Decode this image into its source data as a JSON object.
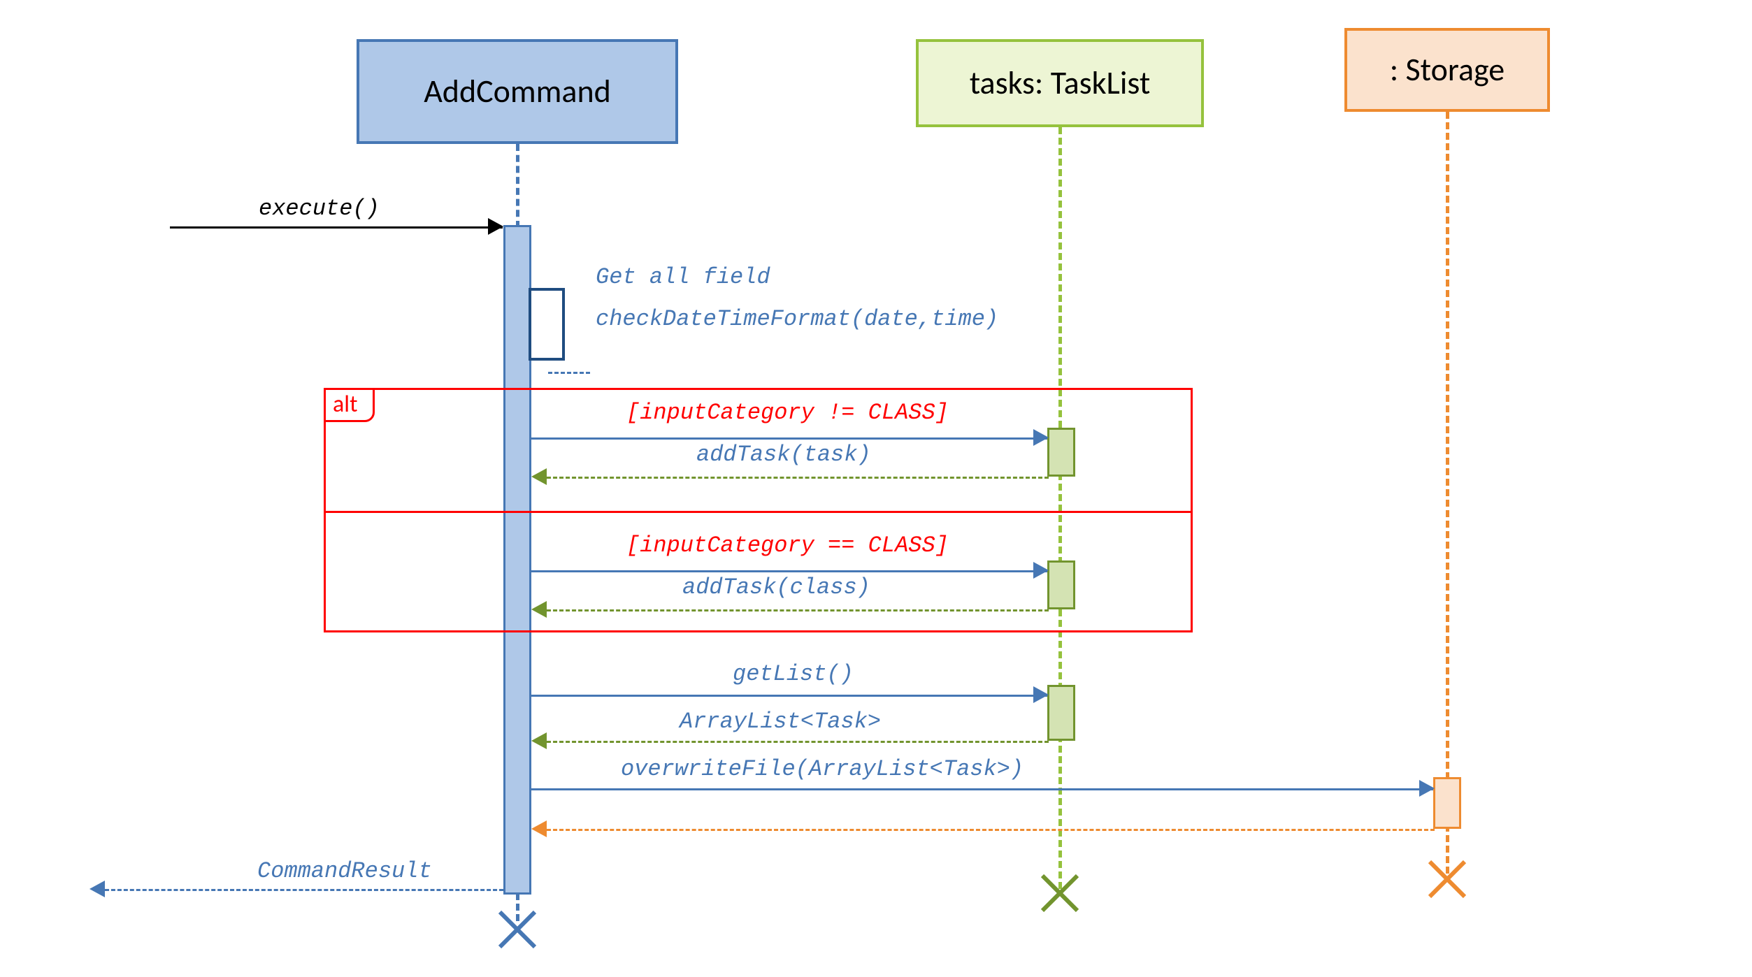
{
  "participants": {
    "addcommand": "AddCommand",
    "tasklist": "tasks: TaskList",
    "storage": ": Storage"
  },
  "messages": {
    "execute": "execute()",
    "note_fields": "Get all field",
    "note_check": "checkDateTimeFormat(date,time)",
    "alt_label": "alt",
    "guard1": "[inputCategory != CLASS]",
    "addtask_task": "addTask(task)",
    "guard2": "[inputCategory == CLASS]",
    "addtask_class": "addTask(class)",
    "getlist": "getList()",
    "arraylist": "ArrayList<Task>",
    "overwrite": "overwriteFile(ArrayList<Task>)",
    "result": "CommandResult"
  }
}
